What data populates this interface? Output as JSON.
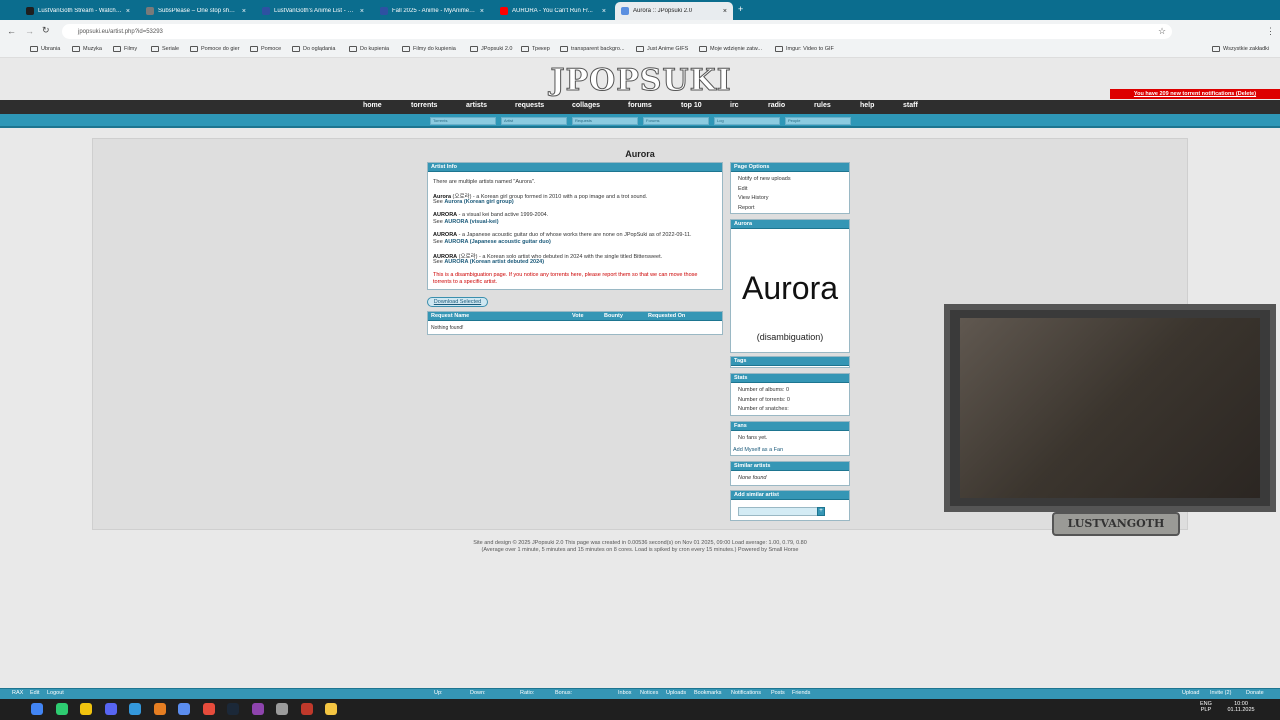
{
  "browser": {
    "tabs": [
      {
        "label": "LustVanGoth Stream - Watch Li...",
        "color": "#1f1f1f"
      },
      {
        "label": "SubsPlease – One stop shop fo...",
        "color": "#7a7a7a"
      },
      {
        "label": "LustVanGoth's Anime List - My...",
        "color": "#2e51a2"
      },
      {
        "label": "Fall 2025 - Anime - MyAnimeLi...",
        "color": "#2e51a2"
      },
      {
        "label": "AURORA - You Can't Run Fr...",
        "color": "#ff0000"
      },
      {
        "label": "Aurora :: JPopsuki 2.0",
        "color": "#5a8fe0"
      }
    ],
    "url": "jpopsuki.eu/artist.php?id=53293",
    "bookmarks": [
      "Ubrania",
      "Muzyka",
      "Filmy",
      "Seriale",
      "Pomoce do gier",
      "Pomoce",
      "Do oglądania",
      "Do kupienia",
      "Filmy do kupienia",
      "JPopsuki 2.0",
      "Трекер",
      "transparent backgro...",
      "Just Anime GIFS",
      "Moje wdzięnie zatw...",
      "Imgur: Video to GIF"
    ],
    "all_bookmarks": "Wszystkie zakładki"
  },
  "site": {
    "logo": "JPOPSUKI",
    "nav": [
      "home",
      "torrents",
      "artists",
      "requests",
      "collages",
      "forums",
      "top 10",
      "irc",
      "radio",
      "rules",
      "help",
      "staff"
    ],
    "notification": "You have 209 new torrent notifications (Delete)",
    "search_placeholders": [
      "Torrents",
      "Artist",
      "Requests",
      "Forums",
      "Log",
      "People"
    ]
  },
  "artist": {
    "name": "Aurora",
    "info_header": "Artist Info",
    "intro": "There are multiple artists named \"Aurora\".",
    "entries": [
      {
        "name": "Aurora",
        "native": "(오로라)",
        "desc": " - a Korean girl group formed in 2010 with a pop image and a trot sound.",
        "see": "See ",
        "link": "Aurora (Korean girl group)"
      },
      {
        "name": "AURORA",
        "native": "",
        "desc": " - a visual kei band active 1999-2004.",
        "see": "See ",
        "link": "AURORA (visual-kei)"
      },
      {
        "name": "AURORA",
        "native": "",
        "desc": " - a Japanese acoustic guitar duo of whose works there are none on JPopSuki as of 2022-09-11.",
        "see": "See ",
        "link": "AURORA (Japanese acoustic guitar duo)"
      },
      {
        "name": "AURORA",
        "native": "(오로라)",
        "desc": " - a Korean solo artist who debuted in 2024 with the single titled Bittersweet.",
        "see": "See ",
        "link": "AURORA (Korean artist debuted 2024)"
      }
    ],
    "warning": "This is a disambiguation page. If you notice any torrents here, please report them so that we can move those torrents to a specific artist.",
    "download_button": "Download Selected",
    "requests_table": {
      "headers": [
        "Request Name",
        "Vote",
        "Bounty",
        "Requested On"
      ],
      "empty": "Nothing found!"
    }
  },
  "sidebar": {
    "page_options": {
      "header": "Page Options",
      "items": [
        "Notify of new uploads",
        "Edit",
        "View History",
        "Report"
      ]
    },
    "image_box": {
      "header": "Aurora",
      "big": "Aurora",
      "sub": "(disambiguation)"
    },
    "tags": {
      "header": "Tags"
    },
    "stats": {
      "header": "Stats",
      "items": [
        "Number of albums: 0",
        "Number of torrents: 0",
        "Number of snatches: "
      ]
    },
    "fans": {
      "header": "Fans",
      "items": [
        "No fans yet."
      ],
      "link": "Add Myself as a Fan"
    },
    "similar": {
      "header": "Similar artists",
      "items": [
        "None found"
      ]
    },
    "add_similar": {
      "header": "Add similar artist",
      "button": "+"
    }
  },
  "footer": {
    "line1": "Site and design © 2025 JPopsuki 2.0     This page was created in 0.00536 second(s) on Nov 01 2025, 09:00     Load average: 1.00, 0.79, 0.80",
    "line2": "(Average over 1 minute, 5 minutes and 15 minutes on 8 cores. Load is spiked by cron every 15 minutes.)     Powered by Small Horse"
  },
  "statusbar": {
    "left": [
      "RAX",
      "Edit",
      "Logout"
    ],
    "stats": [
      "Up:",
      "Down:",
      "Ratio:",
      "Bonus:"
    ],
    "middle": [
      "Inbox",
      "Notices",
      "Uploads",
      "Bookmarks",
      "Notifications",
      "Posts",
      "Friends"
    ],
    "right": [
      "Upload",
      "Invite (2)",
      "Donate"
    ]
  },
  "webcam": {
    "label": "LUSTVANGOTH"
  },
  "taskbar": {
    "lang": "ENG",
    "layout": "PLP",
    "time": "10:00",
    "date": "01.11.2025"
  }
}
